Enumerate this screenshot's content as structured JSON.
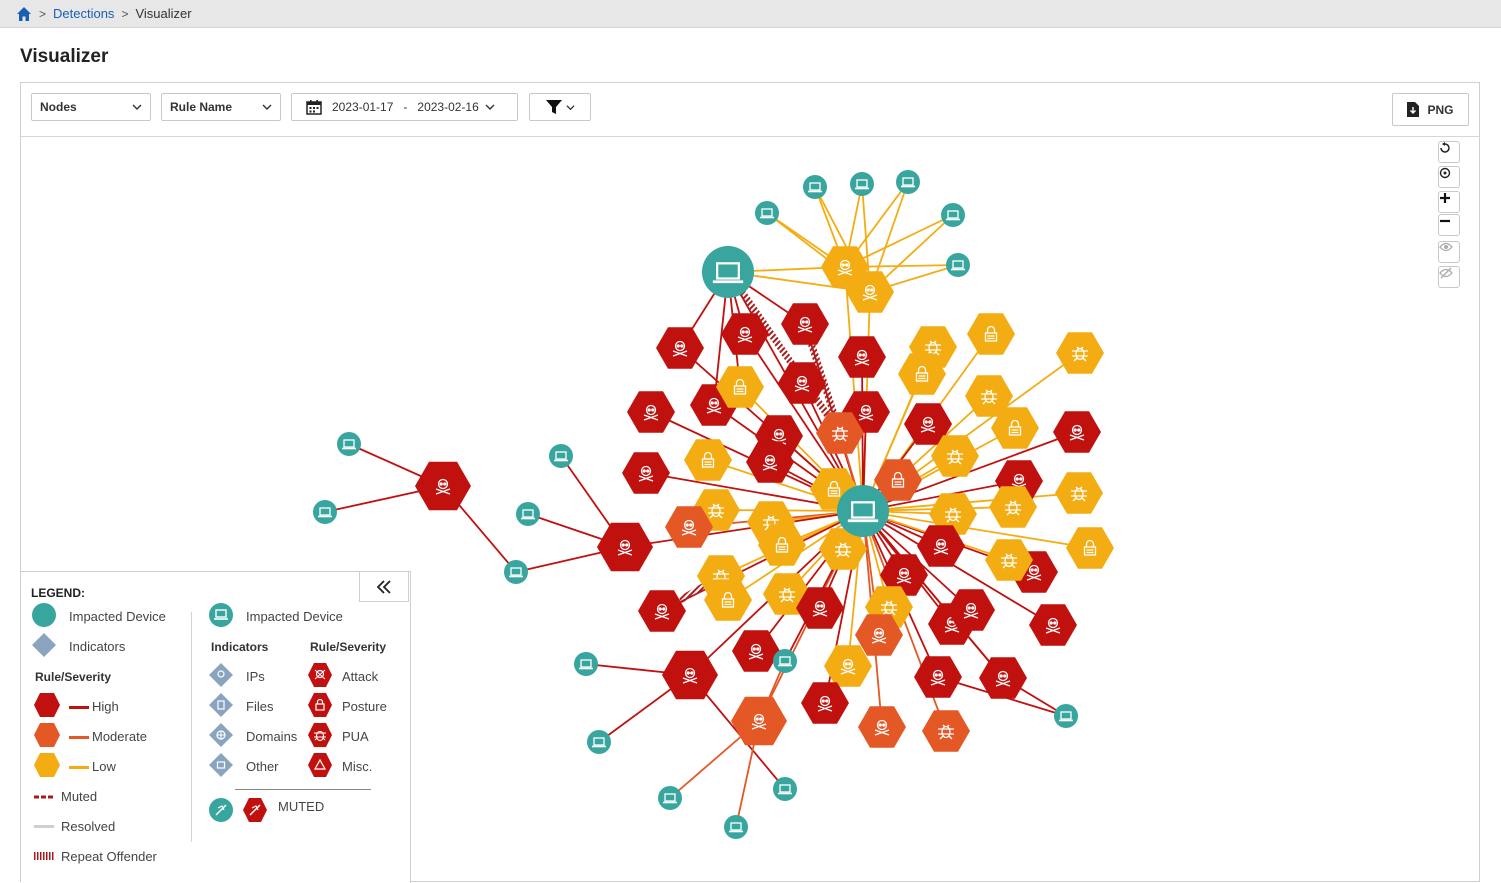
{
  "breadcrumb": {
    "home_icon": "home-icon",
    "separator": ">",
    "link": "Detections",
    "current": "Visualizer"
  },
  "page_title": "Visualizer",
  "toolbar": {
    "view_select": "Nodes",
    "group_select": "Rule Name",
    "date_start": "2023-01-17",
    "date_sep": "-",
    "date_end": "2023-02-16",
    "filter_icon": "filter-icon",
    "png_label": "PNG"
  },
  "zoom_controls": [
    "reset-icon",
    "center-icon",
    "zoom-in-icon",
    "zoom-out-icon",
    "show-icon",
    "hide-icon"
  ],
  "legend": {
    "title": "LEGEND:",
    "left": {
      "impacted_device": "Impacted Device",
      "indicators": "Indicators",
      "rule_severity": "Rule/Severity",
      "high": "High",
      "moderate": "Moderate",
      "low": "Low",
      "muted": "Muted",
      "resolved": "Resolved",
      "repeat_offender": "Repeat Offender"
    },
    "right": {
      "impacted_device": "Impacted Device",
      "indicators_title": "Indicators",
      "rule_severity_title": "Rule/Severity",
      "ips": "IPs",
      "files": "Files",
      "domains": "Domains",
      "other": "Other",
      "attack": "Attack",
      "posture": "Posture",
      "pua": "PUA",
      "misc": "Misc.",
      "muted": "MUTED"
    },
    "collapse_icon": "double-chevron-left-icon"
  },
  "colors": {
    "device": "#38a59e",
    "high": "#c0110f",
    "moderate": "#e35825",
    "low": "#f3ad12",
    "indicator": "#8aa4bf",
    "link": "#1a5fb4"
  }
}
